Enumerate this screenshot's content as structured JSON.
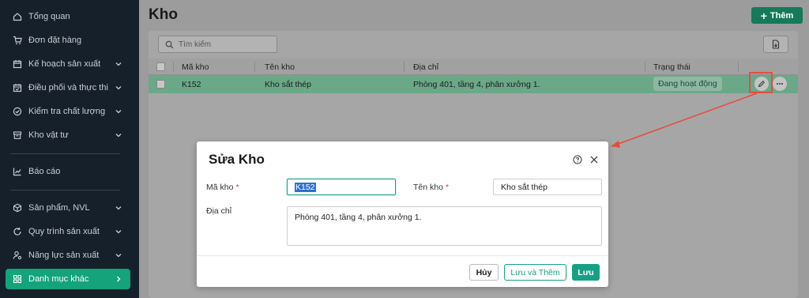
{
  "sidebar": {
    "items": [
      {
        "label": "Tổng quan",
        "icon": "home-icon"
      },
      {
        "label": "Đơn đặt hàng",
        "icon": "cart-icon"
      },
      {
        "label": "Kế hoạch sản xuất",
        "icon": "calendar-icon",
        "has_chevron": true
      },
      {
        "label": "Điều phối và thực thi",
        "icon": "calendar-check-icon",
        "has_chevron": true
      },
      {
        "label": "Kiểm tra chất lượng",
        "icon": "check-circle-icon",
        "has_chevron": true
      },
      {
        "label": "Kho vật tư",
        "icon": "archive-icon",
        "has_chevron": true
      },
      {
        "label": "Báo cáo",
        "icon": "chart-icon"
      },
      {
        "label": "Sản phẩm, NVL",
        "icon": "box-icon",
        "has_chevron": true
      },
      {
        "label": "Quy trình sản xuất",
        "icon": "refresh-icon",
        "has_chevron": true
      },
      {
        "label": "Năng lực sản xuất",
        "icon": "user-gear-icon",
        "has_chevron": true
      },
      {
        "label": "Danh mục khác",
        "icon": "grid-icon",
        "has_chevron": true,
        "active": true
      }
    ]
  },
  "page": {
    "title": "Kho",
    "add_label": "Thêm"
  },
  "search": {
    "placeholder": "Tìm kiếm"
  },
  "table": {
    "columns": [
      "Mã kho",
      "Tên kho",
      "Địa chỉ",
      "Trạng thái"
    ],
    "rows": [
      {
        "code": "K152",
        "name": "Kho sắt thép",
        "address": "Phòng 401, tầng 4, phân xưởng 1.",
        "status": "Đang hoạt động"
      }
    ]
  },
  "modal": {
    "title": "Sửa Kho",
    "code_label": "Mã kho",
    "code_value": "K152",
    "name_label": "Tên kho",
    "name_value": "Kho sắt thép",
    "address_label": "Địa chỉ",
    "address_value": "Phòng 401, tầng 4, phân xưởng 1.",
    "required_mark": "*",
    "cancel_label": "Hủy",
    "save_add_label": "Lưu và Thêm",
    "save_label": "Lưu"
  },
  "colors": {
    "sidebar_bg": "#16202b",
    "accent": "#16a085",
    "active_row": "#6aa888",
    "annotation": "#e74c3c"
  }
}
